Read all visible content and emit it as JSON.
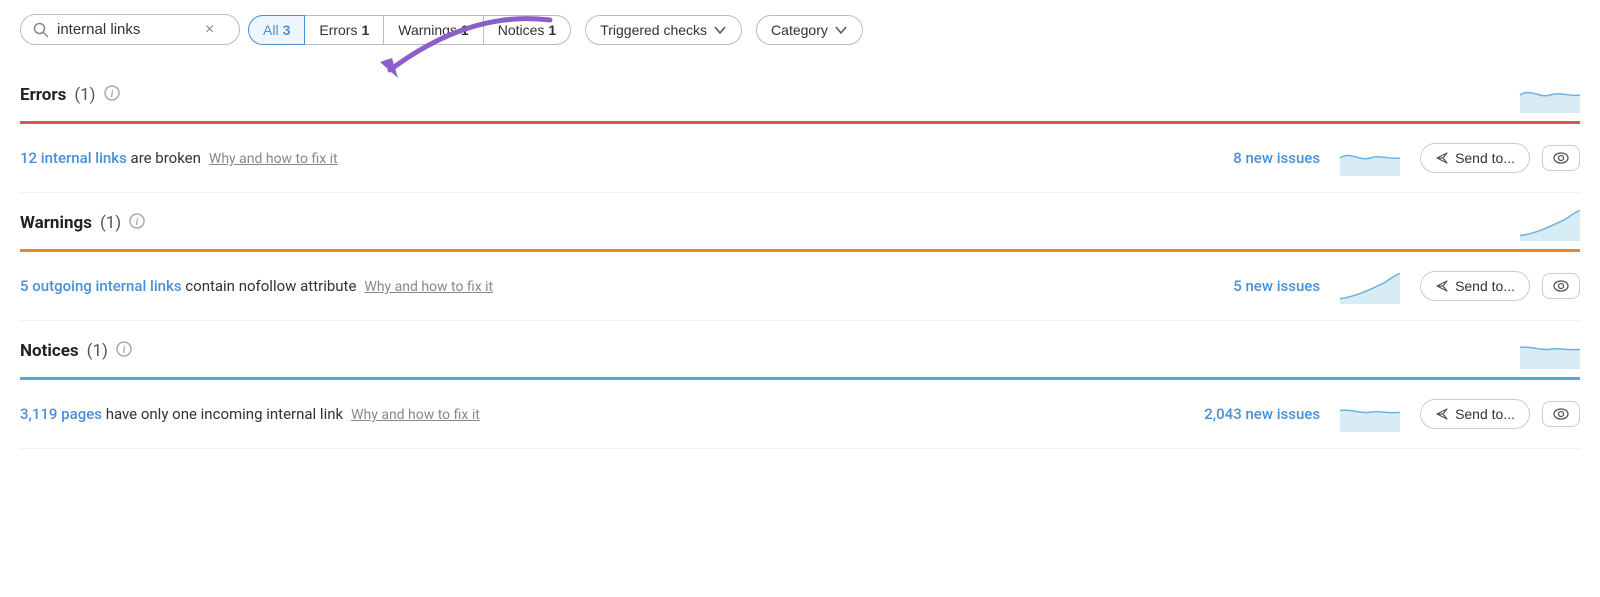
{
  "toolbar": {
    "search_placeholder": "internal links",
    "clear_label": "×",
    "filters": [
      {
        "id": "all",
        "label": "All",
        "count": "3",
        "active": true
      },
      {
        "id": "errors",
        "label": "Errors",
        "count": "1",
        "active": false
      },
      {
        "id": "warnings",
        "label": "Warnings",
        "count": "1",
        "active": false
      },
      {
        "id": "notices",
        "label": "Notices",
        "count": "1",
        "active": false
      }
    ],
    "triggered_checks_label": "Triggered checks",
    "category_label": "Category"
  },
  "sections": [
    {
      "id": "errors",
      "title": "Errors",
      "count": "(1)",
      "divider_color": "red",
      "issues": [
        {
          "link_text": "12 internal links",
          "text_suffix": " are broken",
          "fix_text": "Why and how to fix it",
          "new_issues_text": "8 new issues",
          "send_label": "Send to...",
          "chart_type": "wave_flat"
        }
      ]
    },
    {
      "id": "warnings",
      "title": "Warnings",
      "count": "(1)",
      "divider_color": "orange",
      "issues": [
        {
          "link_text": "5 outgoing internal links",
          "text_suffix": " contain nofollow attribute",
          "fix_text": "Why and how to fix it",
          "new_issues_text": "5 new issues",
          "send_label": "Send to...",
          "chart_type": "wave_rising"
        }
      ]
    },
    {
      "id": "notices",
      "title": "Notices",
      "count": "(1)",
      "divider_color": "blue",
      "issues": [
        {
          "link_text": "3,119 pages",
          "text_suffix": " have only one incoming internal link",
          "fix_text": "Why and how to fix it",
          "new_issues_text": "2,043 new issues",
          "send_label": "Send to...",
          "chart_type": "wave_flat2"
        }
      ]
    }
  ]
}
